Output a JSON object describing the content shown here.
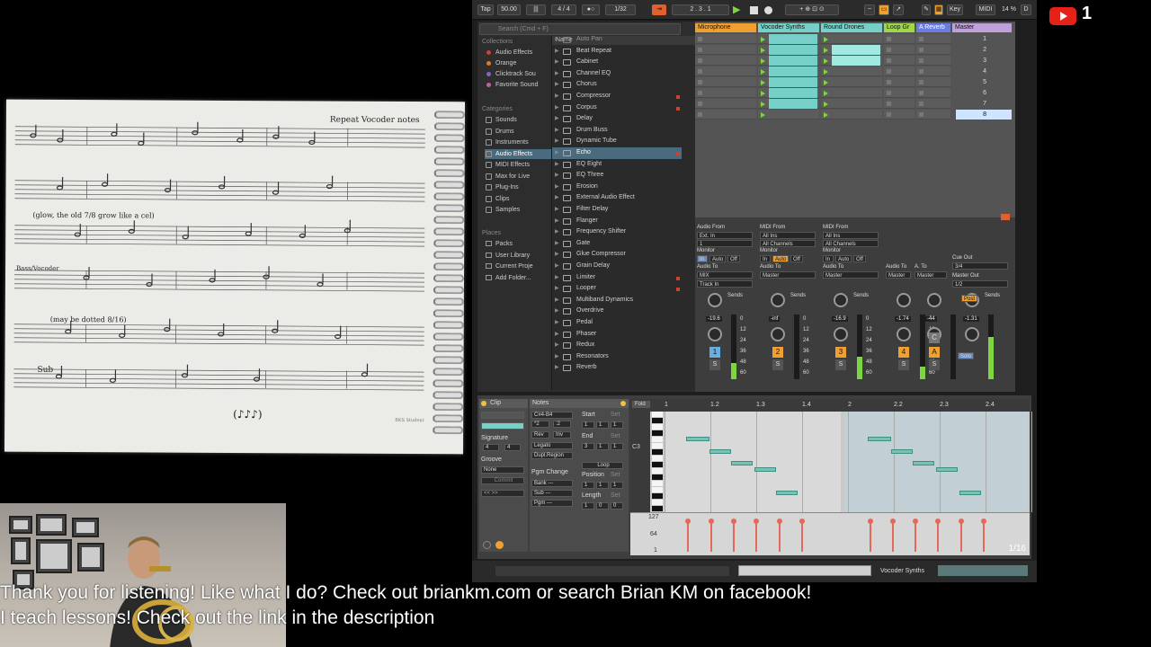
{
  "overlay": {
    "subtitle_line1": "Thank you for listening! Like what I do? Check out briankm.com or search Brian KM on facebook!",
    "subtitle_line2": "I teach lessons! Check out the link in the description",
    "youtube_counter": "1"
  },
  "sheet": {
    "note_repeat_vocoder": "Repeat Vocoder notes",
    "note_glow": "(glow, the old 7/8 grow like a cel)",
    "note_bass_vocoder": "Bass/Vocoder",
    "note_dotted": "(may be dotted 8/16)",
    "note_sub": "Sub",
    "note_brand": "BKS Student",
    "note_rhythm": "(♪♪♪)"
  },
  "ableton": {
    "control_bar": {
      "tap": "Tap",
      "tempo": "50.00",
      "time_sig": "4 / 4",
      "quantize": "1/32",
      "position": "2 . 3 . 1",
      "key": "Key",
      "midi": "MIDI",
      "cpu": "14 %",
      "d": "D"
    },
    "browser": {
      "search_placeholder": "Search (Cmd + F)",
      "collections_label": "Collections",
      "collections": [
        {
          "label": "Audio Effects",
          "color": "#d04030"
        },
        {
          "label": "Orange",
          "color": "#e07a20"
        },
        {
          "label": "Clicktrack Sou",
          "color": "#9060c0"
        },
        {
          "label": "Favorite Sound",
          "color": "#c060a0"
        }
      ],
      "categories_label": "Categories",
      "categories": [
        "Sounds",
        "Drums",
        "Instruments",
        "Audio Effects",
        "MIDI Effects",
        "Max for Live",
        "Plug-Ins",
        "Clips",
        "Samples"
      ],
      "places_label": "Places",
      "places": [
        "Packs",
        "User Library",
        "Current Proje",
        "Add Folder..."
      ],
      "name_header": "Name",
      "items": [
        "Auto Pan",
        "Beat Repeat",
        "Cabinet",
        "Channel EQ",
        "Chorus",
        "Compressor",
        "Corpus",
        "Delay",
        "Drum Buss",
        "Dynamic Tube",
        "Echo",
        "EQ Eight",
        "EQ Three",
        "Erosion",
        "External Audio Effect",
        "Filter Delay",
        "Flanger",
        "Frequency Shifter",
        "Gate",
        "Glue Compressor",
        "Grain Delay",
        "Limiter",
        "Looper",
        "Multiband Dynamics",
        "Overdrive",
        "Pedal",
        "Phaser",
        "Redux",
        "Resonators",
        "Reverb"
      ]
    },
    "tracks": [
      {
        "name": "Microphone",
        "color": "#f0a030"
      },
      {
        "name": "Vocoder Synths",
        "color": "#77d0c7"
      },
      {
        "name": "Round Drones",
        "color": "#77d0c7"
      },
      {
        "name": "Loop Gr",
        "color": "#9ed84a"
      },
      {
        "name": "A Reverb",
        "color": "#6a7ce0"
      },
      {
        "name": "Master",
        "color": "#c0a0d8"
      }
    ],
    "scenes": [
      "1",
      "2",
      "3",
      "4",
      "5",
      "6",
      "7",
      "8"
    ],
    "mixer": {
      "audio_from": "Audio From",
      "midi_from": "MIDI From",
      "ext_in": "Ext. In",
      "all_ins": "All Ins",
      "all_channels": "All Channels",
      "channel_1": "1",
      "monitor": "Monitor",
      "in": "In",
      "auto": "Auto",
      "off": "Off",
      "audio_to": "Audio To",
      "mix": "MIX",
      "master": "Master",
      "track_in": "Track In",
      "cue_out": "Cue Out",
      "cue_val": "3/4",
      "master_out": "Master Out",
      "master_out_val": "1/2",
      "sends": "Sends",
      "post": "Post",
      "solo": "Solo",
      "volumes": [
        "-19.6",
        "-inf",
        "-16.9",
        "-1.74",
        "-44",
        "-1.31"
      ],
      "track_numbers": [
        "1",
        "2",
        "3",
        "4",
        "A"
      ],
      "scale": [
        "0",
        "12",
        "24",
        "36",
        "48",
        "60"
      ],
      "c": "C",
      "s": "S"
    },
    "detail": {
      "clip_tab": "Clip",
      "notes_tab": "Notes",
      "signature": "Signature",
      "sig_num": "4",
      "sig_den": "4",
      "groove": "Groove",
      "groove_val": "None",
      "commit": "Commit",
      "range": "C#4-B4",
      "mult": "*2",
      "div": ":2",
      "rev": "Rev",
      "inv": "Inv",
      "legato": "Legato",
      "dupl_region": "Dupl.Region",
      "pgm_change": "Pgm Change",
      "bank": "Bank ---",
      "sub": "Sub ---",
      "pgm": "Pgm ---",
      "start": "Start",
      "end": "End",
      "loop": "Loop",
      "position": "Position",
      "length": "Length",
      "start_val": [
        "1",
        "1",
        "1"
      ],
      "end_val": [
        "3",
        "1",
        "1"
      ],
      "pos_val": [
        "1",
        "1",
        "1"
      ],
      "len_val": [
        "1",
        "0",
        "0"
      ],
      "set": "Set",
      "fold": "Fold",
      "c3": "C3",
      "ruler": [
        "1",
        "1.2",
        "1.3",
        "1.4",
        "2",
        "2.2",
        "2.3",
        "2.4"
      ],
      "vel_127": "127",
      "vel_64": "64",
      "vel_1": "1",
      "grid": "1/16"
    },
    "status": {
      "track_name": "Vocoder Synths"
    },
    "colors": {
      "teal_clip": "#77d0c7",
      "selected_blue": "#4a6b7d",
      "orange_button": "#f0a030"
    }
  }
}
